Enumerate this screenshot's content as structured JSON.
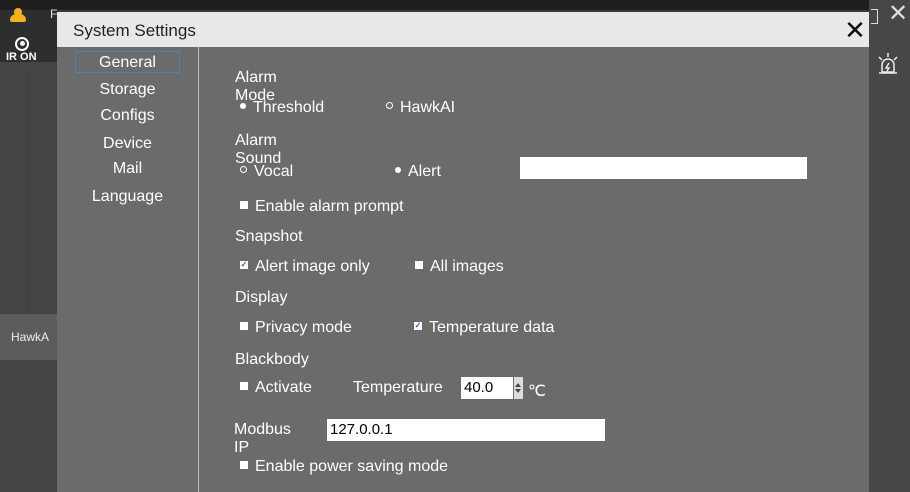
{
  "background": {
    "ir_label": "IR ON",
    "tab_label": "HawkA",
    "title_letter": "F"
  },
  "dialog": {
    "title": "System Settings",
    "close": "✕"
  },
  "nav": [
    "General",
    "Storage",
    "Configs",
    "Device",
    "Mail",
    "Language"
  ],
  "general": {
    "alarm_mode": {
      "label": "Alarm Mode",
      "options": [
        "Threshold",
        "HawkAI"
      ],
      "selected": "Threshold"
    },
    "alarm_sound": {
      "label": "Alarm Sound",
      "options": [
        "Vocal",
        "Alert"
      ],
      "selected": "Alert",
      "path_value": ""
    },
    "enable_alarm_prompt": {
      "label": "Enable alarm prompt",
      "checked": false
    },
    "snapshot": {
      "label": "Snapshot",
      "alert_image_only": {
        "label": "Alert image only",
        "checked": true
      },
      "all_images": {
        "label": "All images",
        "checked": false
      }
    },
    "display": {
      "label": "Display",
      "privacy_mode": {
        "label": "Privacy mode",
        "checked": false
      },
      "temperature_data": {
        "label": "Temperature data",
        "checked": true
      }
    },
    "blackbody": {
      "label": "Blackbody",
      "activate": {
        "label": "Activate",
        "checked": false
      },
      "temperature_label": "Temperature",
      "temperature_value": "40.0",
      "unit": "℃"
    },
    "modbus": {
      "label": "Modbus IP",
      "value": "127.0.0.1"
    },
    "power_saving": {
      "label": "Enable power saving mode",
      "checked": false
    }
  },
  "colors": {
    "dialog_bg": "#6b6b6b",
    "titlebar_bg": "#e8e8e8",
    "nav_active_border": "#4c7fbf"
  }
}
